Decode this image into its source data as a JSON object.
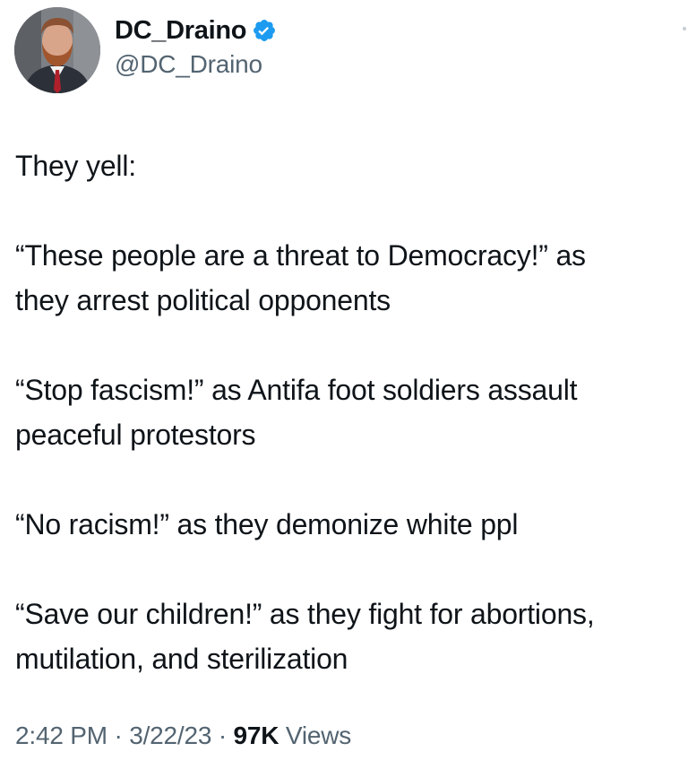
{
  "author": {
    "display_name": "DC_Draino",
    "handle": "@DC_Draino",
    "verified_icon": "verified-badge-icon",
    "verified_color": "#1d9bf0"
  },
  "tweet": {
    "lines": [
      "They yell:",
      "",
      "“These people are a threat to Democracy!” as",
      "they arrest political opponents",
      "",
      "“Stop fascism!” as Antifa foot soldiers assault",
      "peaceful protestors",
      "",
      "“No racism!” as they demonize white ppl",
      "",
      "“Save our children!” as they fight for abortions,",
      "mutilation, and sterilization"
    ]
  },
  "meta": {
    "time": "2:42 PM",
    "separator": "·",
    "date": "3/22/23",
    "views_count": "97K",
    "views_label": "Views"
  }
}
